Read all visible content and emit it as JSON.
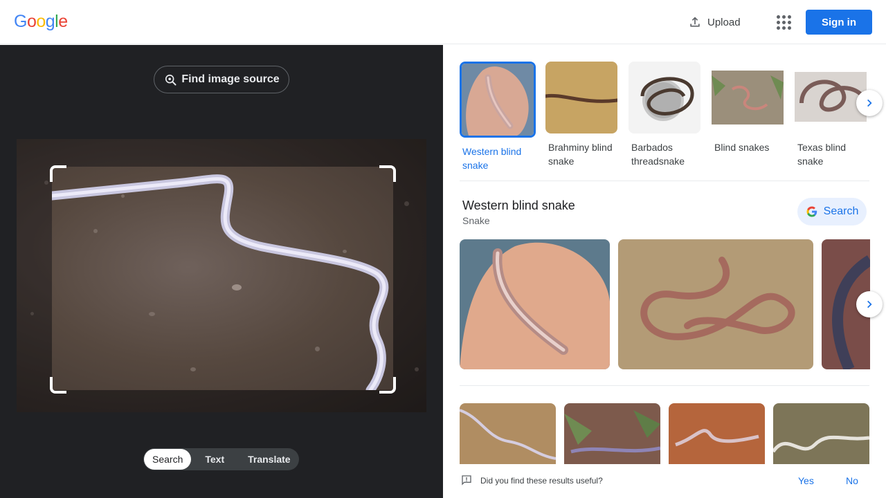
{
  "header": {
    "logo_letters": [
      {
        "ch": "G",
        "color": "#4285f4"
      },
      {
        "ch": "o",
        "color": "#ea4335"
      },
      {
        "ch": "o",
        "color": "#fbbc05"
      },
      {
        "ch": "g",
        "color": "#4285f4"
      },
      {
        "ch": "l",
        "color": "#34a853"
      },
      {
        "ch": "e",
        "color": "#ea4335"
      }
    ],
    "upload_label": "Upload",
    "signin_label": "Sign in"
  },
  "left": {
    "find_source_label": "Find image source",
    "modes": [
      "Search",
      "Text",
      "Translate"
    ],
    "active_mode": "Search"
  },
  "entities": [
    {
      "label": "Western blind snake",
      "selected": true
    },
    {
      "label": "Brahminy blind snake",
      "selected": false
    },
    {
      "label": "Barbados threadsnake",
      "selected": false
    },
    {
      "label": "Blind snakes",
      "selected": false
    },
    {
      "label": "Texas blind snake",
      "selected": false
    }
  ],
  "knowledge": {
    "title": "Western blind snake",
    "subtitle": "Snake",
    "search_label": "Search"
  },
  "feedback": {
    "question": "Did you find these results useful?",
    "yes": "Yes",
    "no": "No"
  },
  "colors": {
    "accent": "#1a73e8",
    "dark_pane": "#202124"
  }
}
